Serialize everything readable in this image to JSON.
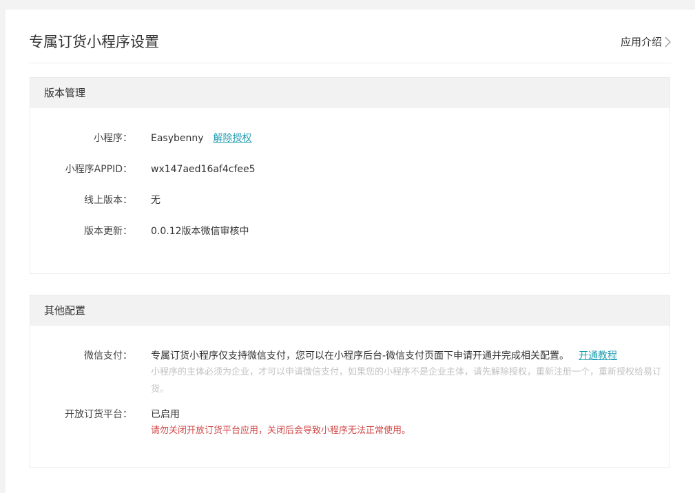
{
  "page": {
    "title": "专属订货小程序设置",
    "intro_label": "应用介绍"
  },
  "version_section": {
    "title": "版本管理",
    "rows": [
      {
        "label": "小程序：",
        "value": "Easybenny",
        "action": "解除授权"
      },
      {
        "label": "小程序APPID：",
        "value": "wx147aed16af4cfee5"
      },
      {
        "label": "线上版本：",
        "value": "无"
      },
      {
        "label": "版本更新：",
        "value": "0.0.12版本微信审核中"
      }
    ]
  },
  "other_section": {
    "title": "其他配置",
    "wechat_pay": {
      "label": "微信支付：",
      "text": "专属订货小程序仅支持微信支付，您可以在小程序后台-微信支付页面下申请开通并完成相关配置。",
      "link": "开通教程",
      "hint": "小程序的主体必须为企业，才可以申请微信支付，如果您的小程序不是企业主体，请先解除授权，重新注册一个，重新授权给易订货。"
    },
    "open_platform": {
      "label": "开放订货平台：",
      "status": "已启用",
      "warning": "请勿关闭开放订货平台应用，关闭后会导致小程序无法正常使用。"
    }
  },
  "colors": {
    "link": "#1f9db2",
    "warning": "#d24848",
    "hint": "#c2c2c2",
    "section_header_bg": "#f2f2f2"
  }
}
